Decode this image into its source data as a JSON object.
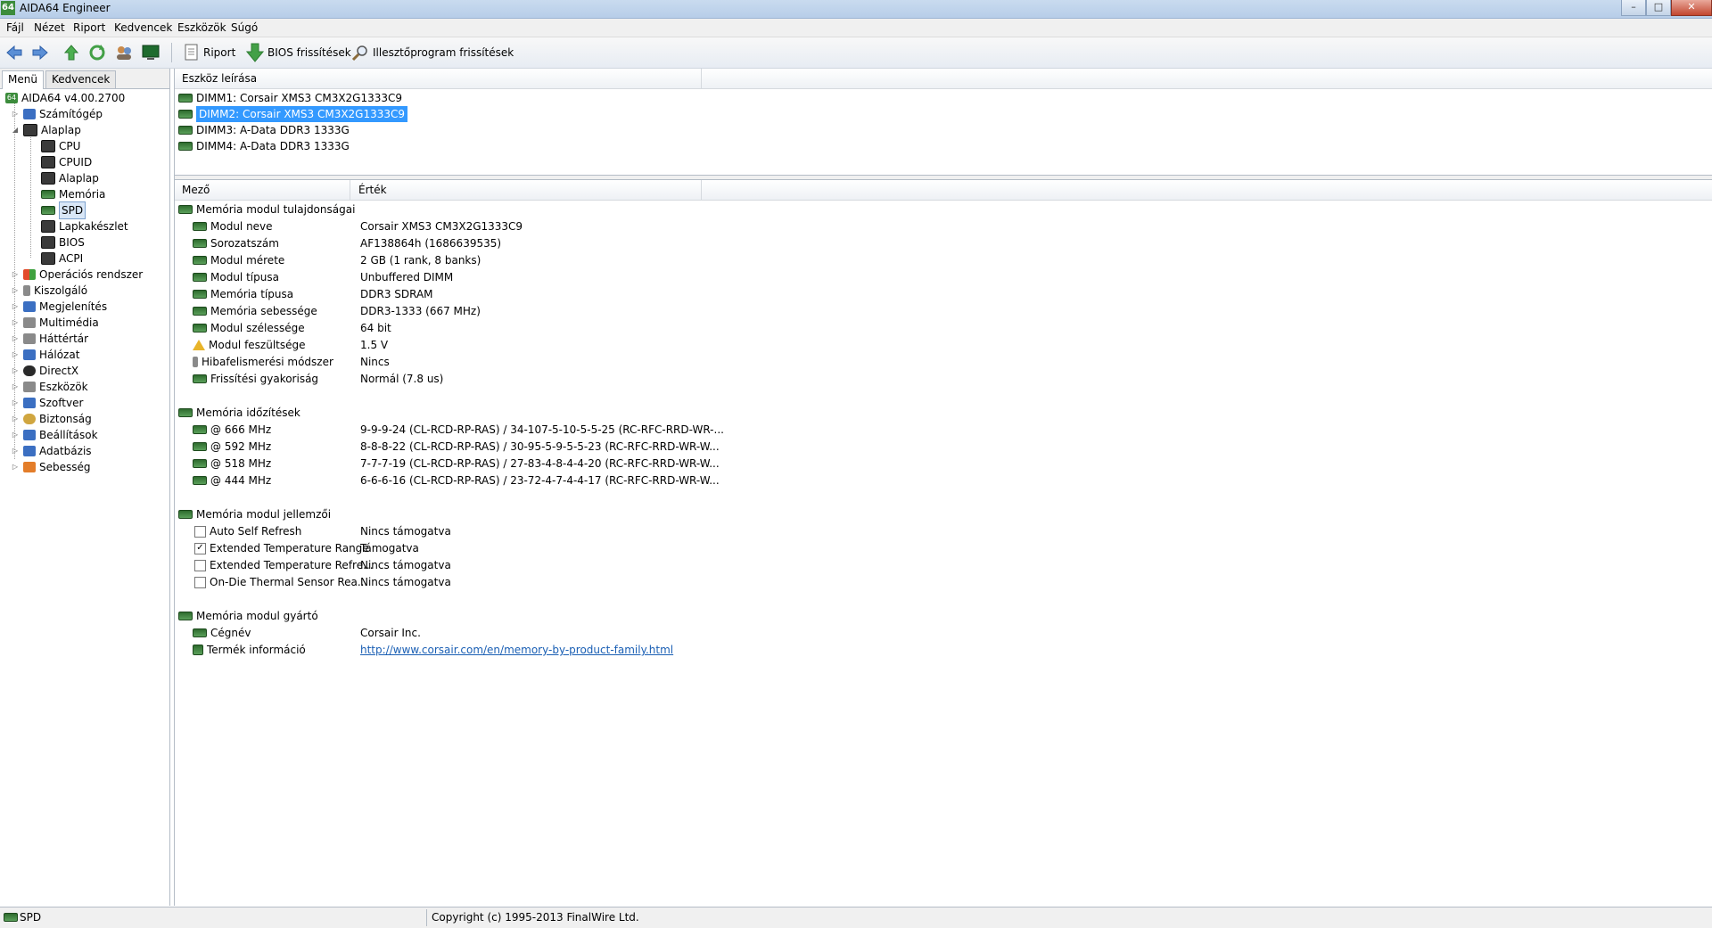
{
  "window": {
    "title": "AIDA64 Engineer",
    "icon_label": "64",
    "controls": [
      "–",
      "□",
      "✕"
    ]
  },
  "menu": [
    "Fájl",
    "Nézet",
    "Riport",
    "Kedvencek",
    "Eszközök",
    "Súgó"
  ],
  "toolbar": {
    "report_label": "Riport",
    "bios_label": "BIOS frissítések",
    "driver_label": "Illesztőprogram frissítések"
  },
  "sidebar": {
    "tabs": [
      "Menü",
      "Kedvencek"
    ],
    "root": "AIDA64 v4.00.2700",
    "items": [
      {
        "label": "Számítógép",
        "icon": "computer-icon"
      },
      {
        "label": "Alaplap",
        "icon": "motherboard-icon"
      },
      {
        "label": "CPU",
        "icon": "cpu-icon"
      },
      {
        "label": "CPUID",
        "icon": "cpuid-icon"
      },
      {
        "label": "Alaplap",
        "icon": "motherboard-icon"
      },
      {
        "label": "Memória",
        "icon": "memory-icon"
      },
      {
        "label": "SPD",
        "icon": "memory-icon"
      },
      {
        "label": "Lapkakészlet",
        "icon": "chipset-icon"
      },
      {
        "label": "BIOS",
        "icon": "bios-icon"
      },
      {
        "label": "ACPI",
        "icon": "acpi-icon"
      },
      {
        "label": "Operációs rendszer",
        "icon": "windows-icon"
      },
      {
        "label": "Kiszolgáló",
        "icon": "server-icon"
      },
      {
        "label": "Megjelenítés",
        "icon": "display-icon"
      },
      {
        "label": "Multimédia",
        "icon": "speaker-icon"
      },
      {
        "label": "Háttértár",
        "icon": "storage-icon"
      },
      {
        "label": "Hálózat",
        "icon": "network-icon"
      },
      {
        "label": "DirectX",
        "icon": "directx-icon"
      },
      {
        "label": "Eszközök",
        "icon": "devices-icon"
      },
      {
        "label": "Szoftver",
        "icon": "software-icon"
      },
      {
        "label": "Biztonság",
        "icon": "security-icon"
      },
      {
        "label": "Beállítások",
        "icon": "settings-icon"
      },
      {
        "label": "Adatbázis",
        "icon": "database-icon"
      },
      {
        "label": "Sebesség",
        "icon": "benchmark-icon"
      }
    ]
  },
  "devices": {
    "header": "Eszköz leírása",
    "items": [
      "DIMM1: Corsair XMS3 CM3X2G1333C9",
      "DIMM2: Corsair XMS3 CM3X2G1333C9",
      "DIMM3: A-Data DDR3 1333G",
      "DIMM4: A-Data DDR3 1333G"
    ],
    "selected_index": 1
  },
  "details": {
    "col_field": "Mező",
    "col_value": "Érték",
    "sections": [
      {
        "title": "Memória modul tulajdonságai",
        "rows": [
          {
            "field": "Modul neve",
            "value": "Corsair XMS3 CM3X2G1333C9"
          },
          {
            "field": "Sorozatszám",
            "value": "AF138864h (1686639535)"
          },
          {
            "field": "Modul mérete",
            "value": "2 GB (1 rank, 8 banks)"
          },
          {
            "field": "Modul típusa",
            "value": "Unbuffered DIMM"
          },
          {
            "field": "Memória típusa",
            "value": "DDR3 SDRAM"
          },
          {
            "field": "Memória sebessége",
            "value": "DDR3-1333 (667 MHz)"
          },
          {
            "field": "Modul szélessége",
            "value": "64 bit"
          },
          {
            "field": "Modul feszültsége",
            "value": "1.5 V"
          },
          {
            "field": "Hibafelismerési módszer",
            "value": "Nincs"
          },
          {
            "field": "Frissítési gyakoriság",
            "value": "Normál (7.8 us)"
          }
        ]
      },
      {
        "title": "Memória időzítések",
        "rows": [
          {
            "field": "@ 666 MHz",
            "value": "9-9-9-24  (CL-RCD-RP-RAS) / 34-107-5-10-5-5-25  (RC-RFC-RRD-WR-..."
          },
          {
            "field": "@ 592 MHz",
            "value": "8-8-8-22  (CL-RCD-RP-RAS) / 30-95-5-9-5-5-23  (RC-RFC-RRD-WR-W..."
          },
          {
            "field": "@ 518 MHz",
            "value": "7-7-7-19  (CL-RCD-RP-RAS) / 27-83-4-8-4-4-20  (RC-RFC-RRD-WR-W..."
          },
          {
            "field": "@ 444 MHz",
            "value": "6-6-6-16  (CL-RCD-RP-RAS) / 23-72-4-7-4-4-17  (RC-RFC-RRD-WR-W..."
          }
        ]
      },
      {
        "title": "Memória modul jellemzői",
        "rows": [
          {
            "field": "Auto Self Refresh",
            "value": "Nincs támogatva",
            "checked": false
          },
          {
            "field": "Extended Temperature Range",
            "value": "Támogatva",
            "checked": true
          },
          {
            "field": "Extended Temperature Refre...",
            "value": "Nincs támogatva",
            "checked": false
          },
          {
            "field": "On-Die Thermal Sensor Rea...",
            "value": "Nincs támogatva",
            "checked": false
          }
        ]
      },
      {
        "title": "Memória modul gyártó",
        "rows": [
          {
            "field": "Cégnév",
            "value": "Corsair Inc."
          },
          {
            "field": "Termék információ",
            "value": "http://www.corsair.com/en/memory-by-product-family.html"
          }
        ]
      }
    ]
  },
  "status": {
    "left": "SPD",
    "right": "Copyright (c) 1995-2013 FinalWire Ltd."
  }
}
